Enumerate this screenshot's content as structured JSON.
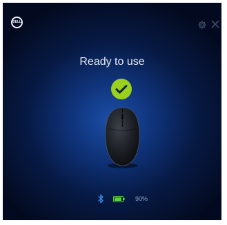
{
  "app": {
    "logo_text": "DELL"
  },
  "device": {
    "status_title": "Ready to use",
    "battery_percent_text": "90%",
    "battery_level": 0.9,
    "connection": "bluetooth"
  },
  "icons": {
    "logo": "dell-logo-icon",
    "settings": "gear-icon",
    "close": "close-icon",
    "ready": "check-circle-icon",
    "device": "mouse-icon",
    "connection": "bluetooth-icon",
    "battery": "battery-icon"
  },
  "colors": {
    "accent_green": "#9ad11c",
    "battery_green": "#5ccf3a",
    "bluetooth_blue": "#2f8be6"
  }
}
